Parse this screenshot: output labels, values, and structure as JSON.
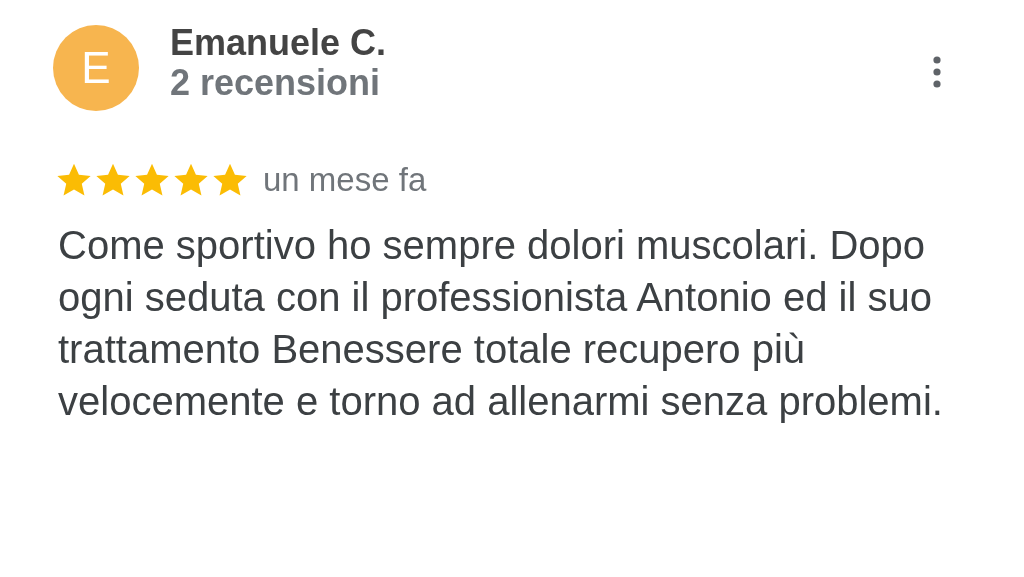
{
  "review": {
    "avatar": {
      "initial": "E",
      "color": "#f7b54f"
    },
    "author": "Emanuele C.",
    "review_count": "2 recensioni",
    "stars": 5,
    "time": "un mese fa",
    "text": "Come sportivo ho sempre dolori muscolari. Dopo ogni seduta con il professionista Antonio ed il suo trattamento Benessere totale recupero più velocemente e torno ad allenarmi senza problemi."
  }
}
